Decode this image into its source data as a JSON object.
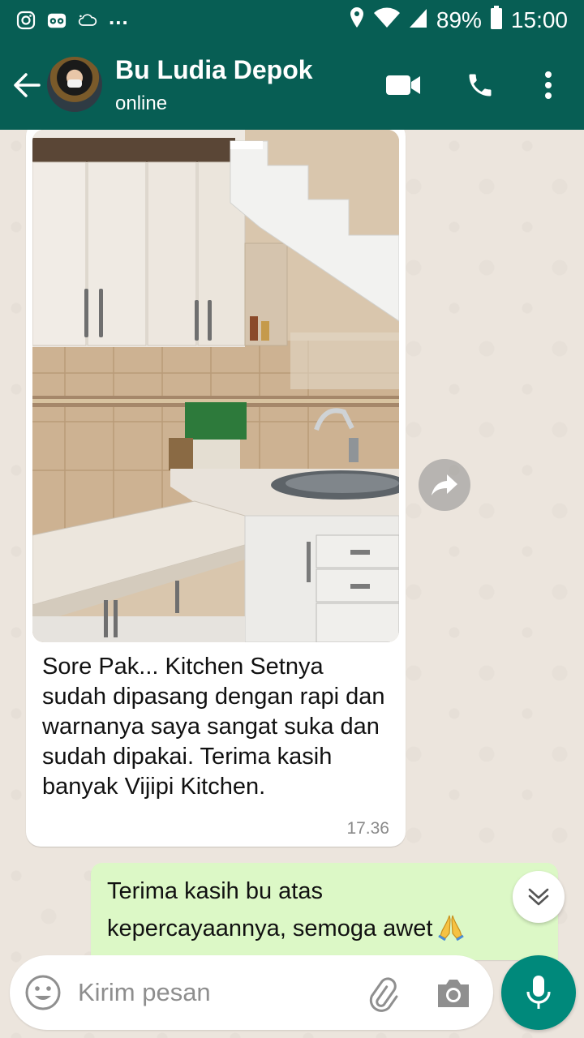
{
  "status_bar": {
    "dots": "...",
    "battery": "89%",
    "time": "15:00",
    "icons": [
      "instagram-icon",
      "tripadvisor-icon",
      "cloud-icon",
      "location-icon",
      "wifi-icon",
      "signal-icon",
      "battery-icon"
    ]
  },
  "header": {
    "contact_name": "Bu Ludia Depok",
    "contact_status": "online",
    "icons": [
      "back-arrow-icon",
      "avatar",
      "video-call-icon",
      "phone-icon",
      "more-vert-icon"
    ]
  },
  "messages": [
    {
      "direction": "incoming",
      "has_photo": true,
      "text": "Sore Pak... Kitchen Setnya sudah dipasang dengan rapi dan warnanya saya sangat suka dan sudah dipakai. Terima kasih banyak Vijipi Kitchen.",
      "time": "17.36"
    },
    {
      "direction": "outgoing",
      "text": "Terima kasih bu atas kepercayaannya, semoga awet",
      "emoji": "folded-hands-emoji"
    }
  ],
  "composer": {
    "placeholder": "Kirim pesan",
    "icons": [
      "emoji-icon",
      "attach-icon",
      "camera-icon",
      "mic-icon"
    ]
  },
  "colors": {
    "header": "#075e54",
    "chat_bg": "#ece5dd",
    "outgoing_bubble": "#dcf8c6",
    "mic_button": "#00897b"
  }
}
